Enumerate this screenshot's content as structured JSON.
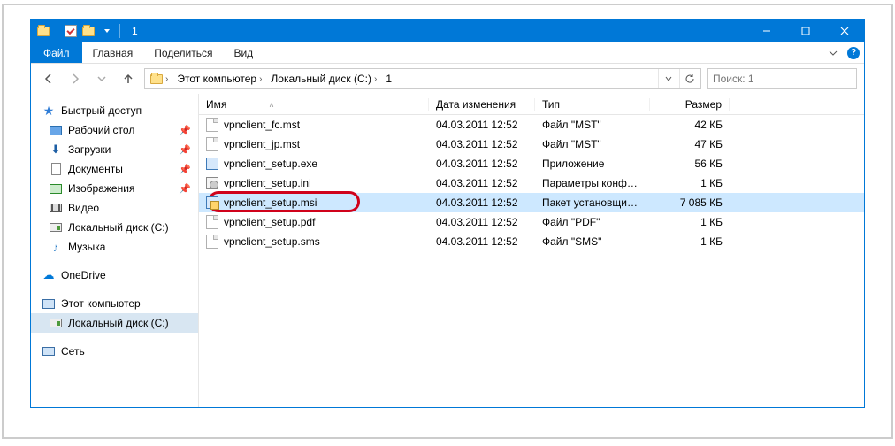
{
  "title": "1",
  "ribbon": {
    "file": "Файл",
    "home": "Главная",
    "share": "Поделиться",
    "view": "Вид"
  },
  "breadcrumb": {
    "pc": "Этот компьютер",
    "drive": "Локальный диск (C:)",
    "folder": "1"
  },
  "search": {
    "placeholder": "Поиск: 1"
  },
  "nav": {
    "quick": "Быстрый доступ",
    "desktop": "Рабочий стол",
    "downloads": "Загрузки",
    "documents": "Документы",
    "pictures": "Изображения",
    "videos": "Видео",
    "localdisk": "Локальный диск (С:)",
    "music": "Музыка",
    "onedrive": "OneDrive",
    "thispc": "Этот компьютер",
    "localdisk2": "Локальный диск (С:)",
    "network": "Сеть"
  },
  "columns": {
    "name": "Имя",
    "date": "Дата изменения",
    "type": "Тип",
    "size": "Размер"
  },
  "files": [
    {
      "name": "vpnclient_fc.mst",
      "date": "04.03.2011 12:52",
      "type": "Файл \"MST\"",
      "size": "42 КБ",
      "icon": "file"
    },
    {
      "name": "vpnclient_jp.mst",
      "date": "04.03.2011 12:52",
      "type": "Файл \"MST\"",
      "size": "47 КБ",
      "icon": "file"
    },
    {
      "name": "vpnclient_setup.exe",
      "date": "04.03.2011 12:52",
      "type": "Приложение",
      "size": "56 КБ",
      "icon": "exe"
    },
    {
      "name": "vpnclient_setup.ini",
      "date": "04.03.2011 12:52",
      "type": "Параметры конф…",
      "size": "1 КБ",
      "icon": "ini"
    },
    {
      "name": "vpnclient_setup.msi",
      "date": "04.03.2011 12:52",
      "type": "Пакет установщи…",
      "size": "7 085 КБ",
      "icon": "msi",
      "selected": true,
      "ring": true
    },
    {
      "name": "vpnclient_setup.pdf",
      "date": "04.03.2011 12:52",
      "type": "Файл \"PDF\"",
      "size": "1 КБ",
      "icon": "file"
    },
    {
      "name": "vpnclient_setup.sms",
      "date": "04.03.2011 12:52",
      "type": "Файл \"SMS\"",
      "size": "1 КБ",
      "icon": "file"
    }
  ]
}
